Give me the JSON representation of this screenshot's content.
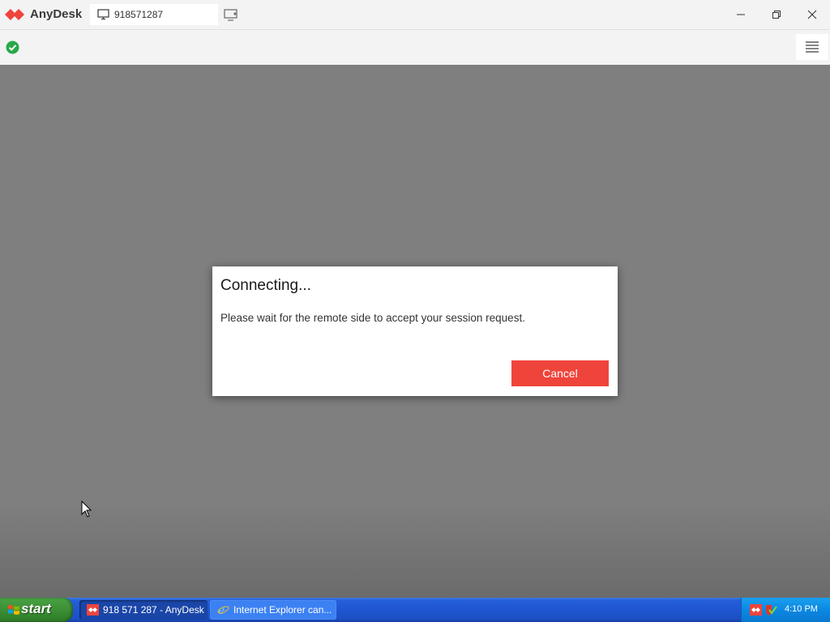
{
  "window": {
    "app_name": "AnyDesk",
    "tab_id": "918571287"
  },
  "dialog": {
    "title": "Connecting...",
    "message": "Please wait for the remote side to accept your session request.",
    "cancel_label": "Cancel"
  },
  "taskbar": {
    "start_label": "start",
    "tasks": [
      {
        "label": "918 571 287 - AnyDesk",
        "active": true,
        "icon": "anydesk-icon"
      },
      {
        "label": "Internet Explorer can...",
        "active": false,
        "icon": "internet-explorer-icon"
      }
    ],
    "clock": "4:10 PM"
  },
  "colors": {
    "brand": "#ef443b",
    "status_ok": "#2aa84a",
    "remote_background": "#7f7f7f"
  }
}
